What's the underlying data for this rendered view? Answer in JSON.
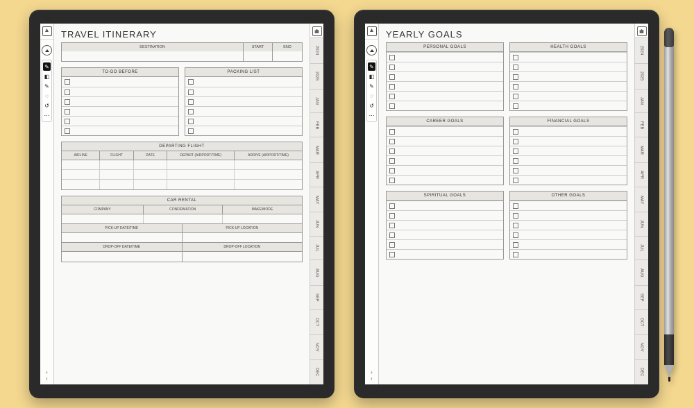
{
  "side_tabs": [
    "2024",
    "2025",
    "JAN",
    "FEB",
    "MAR",
    "APR",
    "MAY",
    "JUN",
    "JUL",
    "AUG",
    "SEP",
    "OCT",
    "NOV",
    "DEC"
  ],
  "toolbar": {
    "tools": [
      "pen",
      "eraser",
      "highlighter",
      "lasso",
      "undo",
      "more"
    ]
  },
  "left_page": {
    "title": "TRAVEL ITINERARY",
    "destination": {
      "dest_label": "DESTINATION",
      "start_label": "START",
      "end_label": "END"
    },
    "todo_header": "TO-DO BEFORE",
    "packing_header": "PACKING LIST",
    "checklist_rows": 6,
    "flight": {
      "header": "DEPARTING FLIGHT",
      "cols": [
        "AIRLINE",
        "FLIGHT",
        "DATE",
        "DEPART (AIRPORT/TIME)",
        "ARRIVE (AIRPORT/TIME)"
      ],
      "rows": 3
    },
    "car": {
      "header": "CAR RENTAL",
      "cols": [
        "COMPANY",
        "CONFIRMATION",
        "MAKE/MODE"
      ],
      "pickup_date": "PICK-UP DATE/TIME",
      "pickup_loc": "PICK-UP LOCATION",
      "dropoff_date": "DROP-OFF DATE/TIME",
      "dropoff_loc": "DROP-OFF LOCATION"
    }
  },
  "right_page": {
    "title": "YEARLY GOALS",
    "sections": [
      [
        "PERSONAL GOALS",
        "HEALTH GOALS"
      ],
      [
        "CAREER GOALS",
        "FINANCIAL GOALS"
      ],
      [
        "SPIRITUAL GOALS",
        "OTHER GOALS"
      ]
    ],
    "rows_per_section": 6
  }
}
